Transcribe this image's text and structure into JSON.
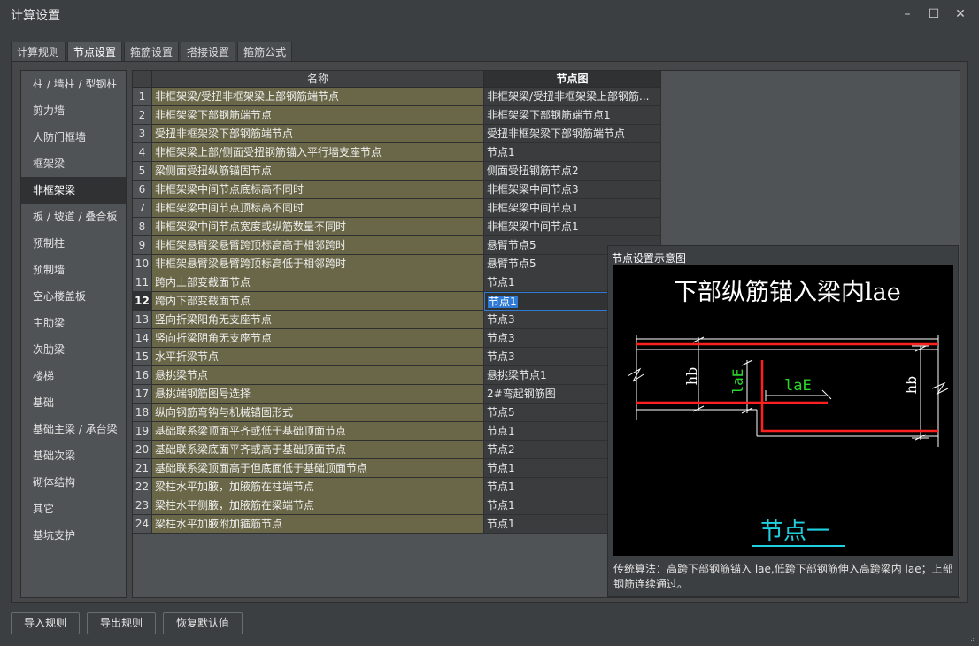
{
  "window": {
    "title": "计算设置",
    "controls": {
      "minimize": "–",
      "maximize": "☐",
      "close": "✕"
    }
  },
  "tabs": [
    {
      "label": "计算规则",
      "active": false
    },
    {
      "label": "节点设置",
      "active": true
    },
    {
      "label": "箍筋设置",
      "active": false
    },
    {
      "label": "搭接设置",
      "active": false
    },
    {
      "label": "箍筋公式",
      "active": false
    }
  ],
  "sidebar": {
    "items": [
      {
        "label": "柱 / 墙柱 / 型钢柱"
      },
      {
        "label": "剪力墙"
      },
      {
        "label": "人防门框墙"
      },
      {
        "label": "框架梁"
      },
      {
        "label": "非框架梁",
        "active": true
      },
      {
        "label": "板 / 坡道 / 叠合板"
      },
      {
        "label": "预制柱"
      },
      {
        "label": "预制墙"
      },
      {
        "label": "空心楼盖板"
      },
      {
        "label": "主肋梁"
      },
      {
        "label": "次肋梁"
      },
      {
        "label": "楼梯"
      },
      {
        "label": "基础"
      },
      {
        "label": "基础主梁 / 承台梁"
      },
      {
        "label": "基础次梁"
      },
      {
        "label": "砌体结构"
      },
      {
        "label": "其它"
      },
      {
        "label": "基坑支护"
      }
    ]
  },
  "table": {
    "headers": {
      "name": "名称",
      "node": "节点图"
    },
    "selected_row": 12,
    "rows": [
      {
        "idx": "1",
        "name": "非框架梁/受扭非框架梁上部钢筋端节点",
        "node": "非框架梁/受扭非框架梁上部钢筋..."
      },
      {
        "idx": "2",
        "name": "非框架梁下部钢筋端节点",
        "node": "非框架梁下部钢筋端节点1"
      },
      {
        "idx": "3",
        "name": "受扭非框架梁下部钢筋端节点",
        "node": "受扭非框架梁下部钢筋端节点"
      },
      {
        "idx": "4",
        "name": "非框架梁上部/侧面受扭钢筋锚入平行墙支座节点",
        "node": "节点1"
      },
      {
        "idx": "5",
        "name": "梁侧面受扭纵筋锚固节点",
        "node": "侧面受扭钢筋节点2"
      },
      {
        "idx": "6",
        "name": "非框架梁中间节点底标高不同时",
        "node": "非框架梁中间节点3"
      },
      {
        "idx": "7",
        "name": "非框架梁中间节点顶标高不同时",
        "node": "非框架梁中间节点1"
      },
      {
        "idx": "8",
        "name": "非框架梁中间节点宽度或纵筋数量不同时",
        "node": "非框架梁中间节点1"
      },
      {
        "idx": "9",
        "name": "非框架悬臂梁悬臂跨顶标高高于相邻跨时",
        "node": "悬臂节点5"
      },
      {
        "idx": "10",
        "name": "非框架悬臂梁悬臂跨顶标高低于相邻跨时",
        "node": "悬臂节点5"
      },
      {
        "idx": "11",
        "name": "跨内上部变截面节点",
        "node": "节点1"
      },
      {
        "idx": "12",
        "name": "跨内下部变截面节点",
        "node": "节点1"
      },
      {
        "idx": "13",
        "name": "竖向折梁阳角无支座节点",
        "node": "节点3"
      },
      {
        "idx": "14",
        "name": "竖向折梁阴角无支座节点",
        "node": "节点3"
      },
      {
        "idx": "15",
        "name": "水平折梁节点",
        "node": "节点3"
      },
      {
        "idx": "16",
        "name": "悬挑梁节点",
        "node": "悬挑梁节点1"
      },
      {
        "idx": "17",
        "name": "悬挑端钢筋图号选择",
        "node": "2#弯起钢筋图"
      },
      {
        "idx": "18",
        "name": "纵向钢筋弯钩与机械锚固形式",
        "node": "节点5"
      },
      {
        "idx": "19",
        "name": "基础联系梁顶面平齐或低于基础顶面节点",
        "node": "节点1"
      },
      {
        "idx": "20",
        "name": "基础联系梁底面平齐或高于基础顶面节点",
        "node": "节点2"
      },
      {
        "idx": "21",
        "name": "基础联系梁顶面高于但底面低于基础顶面节点",
        "node": "节点1"
      },
      {
        "idx": "22",
        "name": "梁柱水平加腋，加腋筋在柱端节点",
        "node": "节点1"
      },
      {
        "idx": "23",
        "name": "梁柱水平侧腋，加腋筋在梁端节点",
        "node": "节点1"
      },
      {
        "idx": "24",
        "name": "梁柱水平加腋附加箍筋节点",
        "node": "节点1"
      }
    ]
  },
  "preview": {
    "title": "节点设置示意图",
    "diagram": {
      "heading": "下部纵筋锚入梁内lae",
      "label_hb_left": "hb",
      "label_hb_right": "hb",
      "label_lae_vertical": "laE",
      "label_lae_horizontal": "laE",
      "caption": "节点一",
      "colors": {
        "rebar": "#ff2020",
        "dimension": "#ffffff",
        "green_label": "#2bd62b",
        "caption": "#20d0e0"
      }
    },
    "description": "传统算法：高跨下部钢筋锚入 lae,低跨下部钢筋伸入高跨梁内 lae；上部钢筋连续通过。"
  },
  "buttons": {
    "import": "导入规则",
    "export": "导出规则",
    "restore": "恢复默认值"
  }
}
